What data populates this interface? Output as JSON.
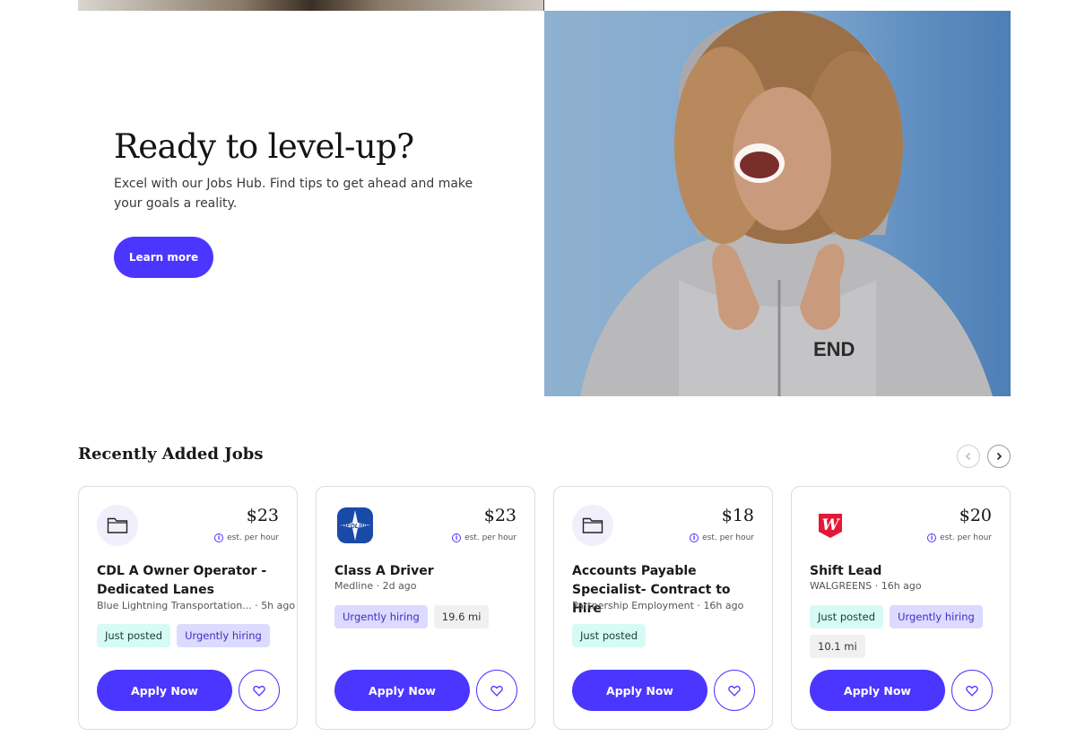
{
  "hero": {
    "title": "Ready to level-up?",
    "subtitle": "Excel with our Jobs Hub. Find tips to get ahead and make your goals a reality.",
    "cta_label": "Learn more"
  },
  "jobs_section": {
    "title": "Recently Added Jobs",
    "prev_icon": "chevron-left-icon",
    "next_icon": "chevron-right-icon"
  },
  "jobs": [
    {
      "logo": "folder-icon",
      "pay": "$23",
      "pay_note": "est. per hour",
      "title": "CDL A Owner Operator - Dedicated Lanes",
      "company": "Blue Lightning Transportation...",
      "posted": "5h ago",
      "tags": [
        "Just posted",
        "Urgently hiring"
      ],
      "apply_label": "Apply Now"
    },
    {
      "logo": "medline-logo",
      "logo_text": "MEDLINE",
      "pay": "$23",
      "pay_note": "est. per hour",
      "title": "Class A Driver",
      "company": "Medline",
      "posted": "2d ago",
      "tags": [
        "Urgently hiring",
        "19.6 mi"
      ],
      "apply_label": "Apply Now"
    },
    {
      "logo": "folder-icon",
      "pay": "$18",
      "pay_note": "est. per hour",
      "title": "Accounts Payable Specialist- Contract to Hire",
      "company": "Partnership Employment",
      "posted": "16h ago",
      "tags": [
        "Just posted"
      ],
      "apply_label": "Apply Now"
    },
    {
      "logo": "walgreens-logo",
      "pay": "$20",
      "pay_note": "est. per hour",
      "title": "Shift Lead",
      "company": "WALGREENS",
      "posted": "16h ago",
      "tags": [
        "Just posted",
        "Urgently hiring",
        "10.1 mi"
      ],
      "apply_label": "Apply Now"
    }
  ],
  "colors": {
    "accent": "#4a36ff",
    "tag_new_bg": "#d6fbf4",
    "tag_urgent_bg": "#dddaff",
    "tag_distance_bg": "#f0f0f0"
  }
}
